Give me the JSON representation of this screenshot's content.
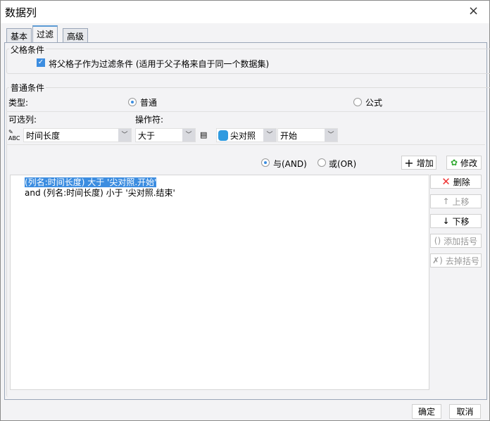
{
  "window": {
    "title": "数据列",
    "close_icon": "×"
  },
  "tabs": [
    {
      "label": "基本"
    },
    {
      "label": "过滤"
    },
    {
      "label": "高级"
    }
  ],
  "parent": {
    "legend": "父格条件",
    "checkbox_label": "将父格子作为过滤条件 (适用于父子格来自于同一个数据集)",
    "checked": true
  },
  "normal": {
    "legend": "普通条件",
    "type_label": "类型:",
    "type_normal": "普通",
    "type_formula": "公式",
    "selected_type": "普通",
    "column_label": "可选列:",
    "column_value": "时间长度",
    "operator_label": "操作符:",
    "operator_value": "大于",
    "dataset_value": "尖对照",
    "field_value": "开始"
  },
  "logic": {
    "and": "与(AND)",
    "or": "或(OR)",
    "selected": "and"
  },
  "buttons": {
    "add": "增加",
    "modify": "修改",
    "delete": "删除",
    "up": "上移",
    "down": "下移",
    "add_paren": "添加括号",
    "remove_paren": "去掉括号",
    "ok": "确定",
    "cancel": "取消"
  },
  "conditions": [
    {
      "text": "(列名:时间长度) 大于 '尖对照.开始'",
      "selected": true
    },
    {
      "text": "and (列名:时间长度) 小于 '尖对照.结束'",
      "selected": false
    }
  ]
}
